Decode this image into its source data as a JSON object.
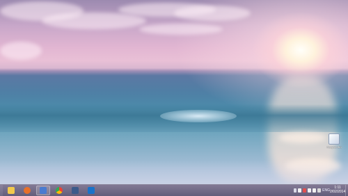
{
  "desktop": {
    "wallpaper": "beach-sunset-wallpaper",
    "icons": [
      {
        "name": "recycle-bin-icon",
        "label": "Recycle Bin"
      }
    ]
  },
  "taskbar": {
    "pinned": [
      {
        "name": "file-explorer-icon",
        "color": "#f2c94c"
      },
      {
        "name": "firefox-icon",
        "color": "#e8702a"
      },
      {
        "name": "network-app-icon",
        "color": "#4a7bd0"
      },
      {
        "name": "chrome-icon",
        "color": "#34a853"
      },
      {
        "name": "computer-icon",
        "color": "#3c5a8a"
      },
      {
        "name": "photoshop-icon",
        "color": "#1a73c9"
      }
    ],
    "tray": {
      "language": "ENG"
    },
    "clock": {
      "time": "1:11",
      "date": "2/02/2014"
    }
  }
}
